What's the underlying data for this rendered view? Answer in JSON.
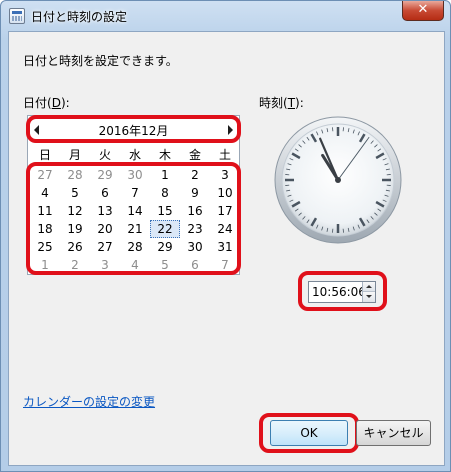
{
  "window": {
    "title": "日付と時刻の設定",
    "close_label": "✕"
  },
  "dialog": {
    "intro": "日付と時刻を設定できます。",
    "date_label_prefix": "日付(",
    "date_label_key": "D",
    "date_label_suffix": "):",
    "time_label_prefix": "時刻(",
    "time_label_key": "T",
    "time_label_suffix": "):"
  },
  "calendar": {
    "month_title": "2016年12月",
    "weekdays": [
      "日",
      "月",
      "火",
      "水",
      "木",
      "金",
      "土"
    ],
    "weeks": [
      [
        "27",
        "28",
        "29",
        "30",
        "1",
        "2",
        "3"
      ],
      [
        "4",
        "5",
        "6",
        "7",
        "8",
        "9",
        "10"
      ],
      [
        "11",
        "12",
        "13",
        "14",
        "15",
        "16",
        "17"
      ],
      [
        "18",
        "19",
        "20",
        "21",
        "22",
        "23",
        "24"
      ],
      [
        "25",
        "26",
        "27",
        "28",
        "29",
        "30",
        "31"
      ],
      [
        "1",
        "2",
        "3",
        "4",
        "5",
        "6",
        "7"
      ]
    ],
    "other_month_cells": [
      [
        0,
        0
      ],
      [
        0,
        1
      ],
      [
        0,
        2
      ],
      [
        0,
        3
      ],
      [
        5,
        0
      ],
      [
        5,
        1
      ],
      [
        5,
        2
      ],
      [
        5,
        3
      ],
      [
        5,
        4
      ],
      [
        5,
        5
      ],
      [
        5,
        6
      ]
    ],
    "selected_day": "22"
  },
  "clock": {
    "hour": 10,
    "minute": 56,
    "second": 6
  },
  "time_field": {
    "value": "10:56:06"
  },
  "links": {
    "calendar_settings": "カレンダーの設定の変更"
  },
  "buttons": {
    "ok": "OK",
    "cancel": "キャンセル"
  },
  "colors": {
    "highlight_outline": "#e0101a",
    "link": "#0a57c2"
  }
}
